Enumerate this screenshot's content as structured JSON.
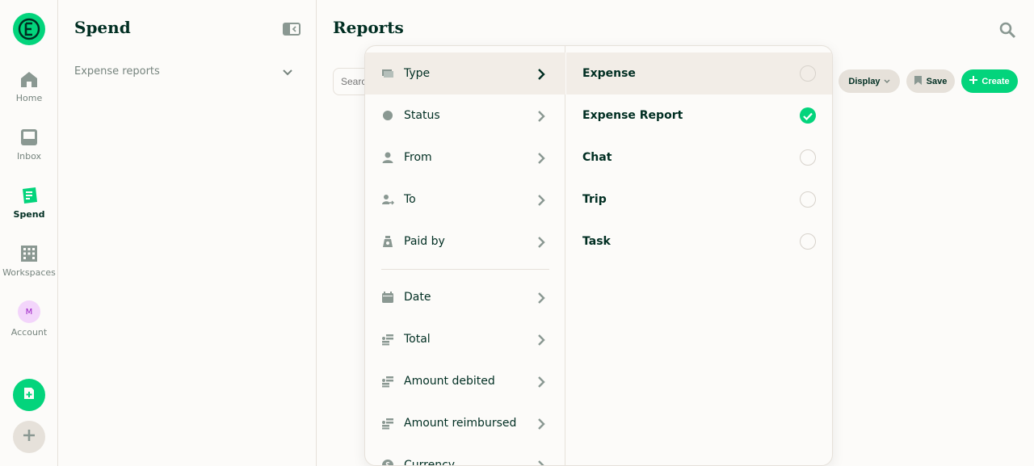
{
  "colors": {
    "brand_green": "#03d47c",
    "text_dark": "#002e22",
    "text_muted": "#76847e",
    "border": "#e6e1da",
    "highlight": "#f2ede7",
    "avatar_bg": "#f3d5fb",
    "avatar_text": "#9b1fc4"
  },
  "rail": {
    "logo_icon": "expensify-logo-icon",
    "items": [
      {
        "label": "Home",
        "icon": "home-icon"
      },
      {
        "label": "Inbox",
        "icon": "inbox-icon"
      },
      {
        "label": "Spend",
        "icon": "receipt-icon",
        "active": true
      },
      {
        "label": "Workspaces",
        "icon": "building-icon"
      },
      {
        "label": "Account",
        "avatar_initial": "M"
      }
    ],
    "fab_icon": "new-expense-icon",
    "add_icon": "plus-icon"
  },
  "sidepanel": {
    "title": "Spend",
    "collapse_icon": "collapse-sidebar-icon",
    "items": [
      {
        "label": "Expense reports",
        "icon": "chevron-down-icon"
      }
    ]
  },
  "main": {
    "title": "Reports",
    "search_icon": "search-icon",
    "search_placeholder": "Search",
    "buttons": {
      "display": "Display",
      "save": "Save",
      "create": "Create"
    }
  },
  "filter_popover": {
    "filters": [
      {
        "label": "Type",
        "icon": "receipt-type-icon",
        "selected": true
      },
      {
        "label": "Status",
        "icon": "status-dot-icon"
      },
      {
        "label": "From",
        "icon": "person-icon"
      },
      {
        "label": "To",
        "icon": "person-arrow-icon"
      },
      {
        "label": "Paid by",
        "icon": "money-bag-icon"
      },
      {
        "label": "Date",
        "icon": "calendar-icon"
      },
      {
        "label": "Total",
        "icon": "coins-icon"
      },
      {
        "label": "Amount debited",
        "icon": "coins-icon"
      },
      {
        "label": "Amount reimbursed",
        "icon": "coins-icon"
      },
      {
        "label": "Currency",
        "icon": "currency-icon"
      }
    ],
    "options": [
      {
        "label": "Expense",
        "checked": false,
        "highlighted": true
      },
      {
        "label": "Expense Report",
        "checked": true
      },
      {
        "label": "Chat",
        "checked": false
      },
      {
        "label": "Trip",
        "checked": false
      },
      {
        "label": "Task",
        "checked": false
      }
    ]
  }
}
